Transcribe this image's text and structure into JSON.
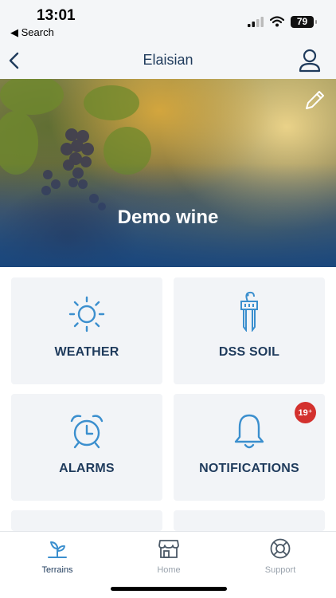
{
  "status": {
    "time": "13:01",
    "back_label": "◀ Search",
    "battery": "79"
  },
  "nav": {
    "title": "Elaisian"
  },
  "hero": {
    "title": "Demo wine"
  },
  "tiles": [
    {
      "label": "WEATHER",
      "icon": "sun-icon"
    },
    {
      "label": "DSS SOIL",
      "icon": "soil-probe-icon"
    },
    {
      "label": "ALARMS",
      "icon": "alarm-clock-icon"
    },
    {
      "label": "NOTIFICATIONS",
      "icon": "bell-icon",
      "badge": "19⁺"
    }
  ],
  "tabs": [
    {
      "label": "Terrains",
      "icon": "sprout-icon",
      "active": true
    },
    {
      "label": "Home",
      "icon": "store-icon",
      "active": false
    },
    {
      "label": "Support",
      "icon": "lifebuoy-icon",
      "active": false
    }
  ],
  "colors": {
    "accent": "#3b8fce",
    "title": "#1f3b5c",
    "badge": "#d3312e",
    "tile_bg": "#f2f4f7",
    "inactive": "#9aa3ad"
  }
}
